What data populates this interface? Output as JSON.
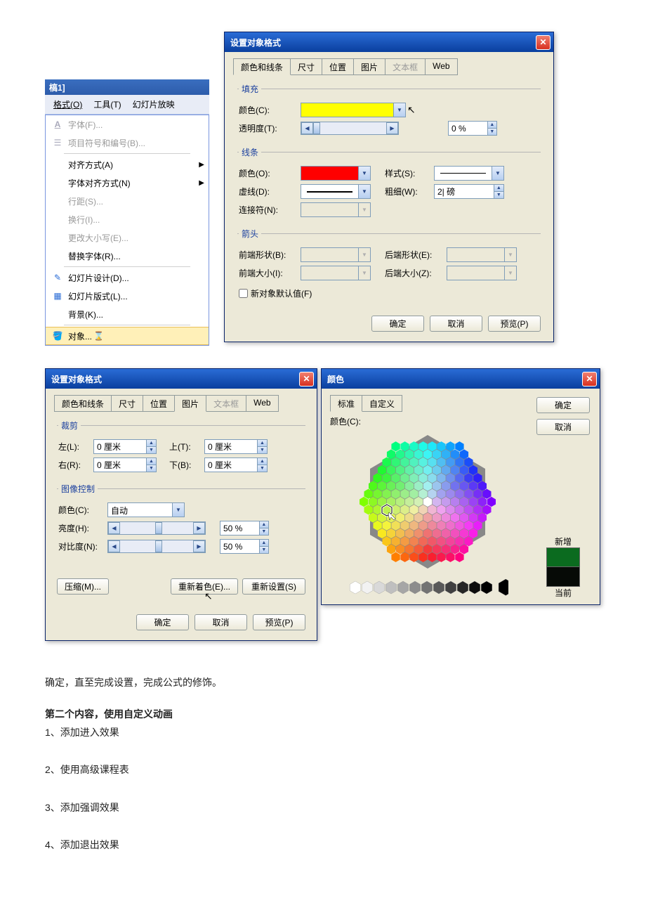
{
  "menu": {
    "title_fragment": "槁1]",
    "bar": {
      "format": "格式(O)",
      "tools": "工具(T)",
      "slideshow": "幻灯片放映"
    },
    "items": [
      {
        "label": "字体(F)...",
        "disabled": true,
        "icon": "A"
      },
      {
        "label": "项目符号和编号(B)...",
        "disabled": true,
        "icon": "list"
      },
      {
        "label": "对齐方式(A)",
        "sub": true
      },
      {
        "label": "字体对齐方式(N)",
        "sub": true
      },
      {
        "label": "行距(S)...",
        "disabled": true
      },
      {
        "label": "换行(I)...",
        "disabled": true
      },
      {
        "label": "更改大小写(E)...",
        "disabled": true
      },
      {
        "label": "替换字体(R)..."
      },
      {
        "label": "幻灯片设计(D)...",
        "icon": "design"
      },
      {
        "label": "幻灯片版式(L)...",
        "icon": "layout"
      },
      {
        "label": "背景(K)..."
      },
      {
        "label": "对象...",
        "highlight": true,
        "icon": "paint",
        "busy": true
      }
    ]
  },
  "dlg1": {
    "title": "设置对象格式",
    "tabs": [
      "颜色和线条",
      "尺寸",
      "位置",
      "图片",
      "文本框",
      "Web"
    ],
    "fill": {
      "legend": "填充",
      "color_label": "颜色(C):",
      "trans_label": "透明度(T):",
      "trans_value": "0 %"
    },
    "line": {
      "legend": "线条",
      "color_label": "颜色(O):",
      "style_label": "样式(S):",
      "dash_label": "虚线(D):",
      "weight_label": "粗细(W):",
      "weight_value": "2| 磅",
      "connector_label": "连接符(N):"
    },
    "arrow": {
      "legend": "箭头",
      "begin_shape": "前端形状(B):",
      "end_shape": "后端形状(E):",
      "begin_size": "前端大小(I):",
      "end_size": "后端大小(Z):"
    },
    "default_label": "新对象默认值(F)",
    "buttons": {
      "ok": "确定",
      "cancel": "取消",
      "preview": "预览(P)"
    }
  },
  "dlg2": {
    "title": "设置对象格式",
    "tabs": [
      "颜色和线条",
      "尺寸",
      "位置",
      "图片",
      "文本框",
      "Web"
    ],
    "crop": {
      "legend": "裁剪",
      "left": "左(L):",
      "left_v": "0 厘米",
      "top": "上(T):",
      "top_v": "0 厘米",
      "right": "右(R):",
      "right_v": "0 厘米",
      "bottom": "下(B):",
      "bottom_v": "0 厘米"
    },
    "imgctrl": {
      "legend": "图像控制",
      "color_label": "颜色(C):",
      "color_value": "自动",
      "bright_label": "亮度(H):",
      "bright_v": "50 %",
      "contrast_label": "对比度(N):",
      "contrast_v": "50 %"
    },
    "compress": "压缩(M)...",
    "recolor": "重新着色(E)...",
    "reset": "重新设置(S)",
    "buttons": {
      "ok": "确定",
      "cancel": "取消",
      "preview": "预览(P)"
    }
  },
  "dlg3": {
    "title": "颜色",
    "tabs": [
      "标准",
      "自定义"
    ],
    "color_label": "颜色(C):",
    "new_label": "新增",
    "current_label": "当前",
    "new_color": "#0b6b1f",
    "current_color": "#060a06",
    "buttons": {
      "ok": "确定",
      "cancel": "取消"
    }
  },
  "doc": {
    "p1": "确定，直至完成设置，完成公式的修饰。",
    "h2": "第二个内容，使用自定义动画",
    "li1": "1、添加进入效果",
    "li2": "2、使用高级课程表",
    "li3": "3、添加强调效果",
    "li4": "4、添加退出效果"
  }
}
